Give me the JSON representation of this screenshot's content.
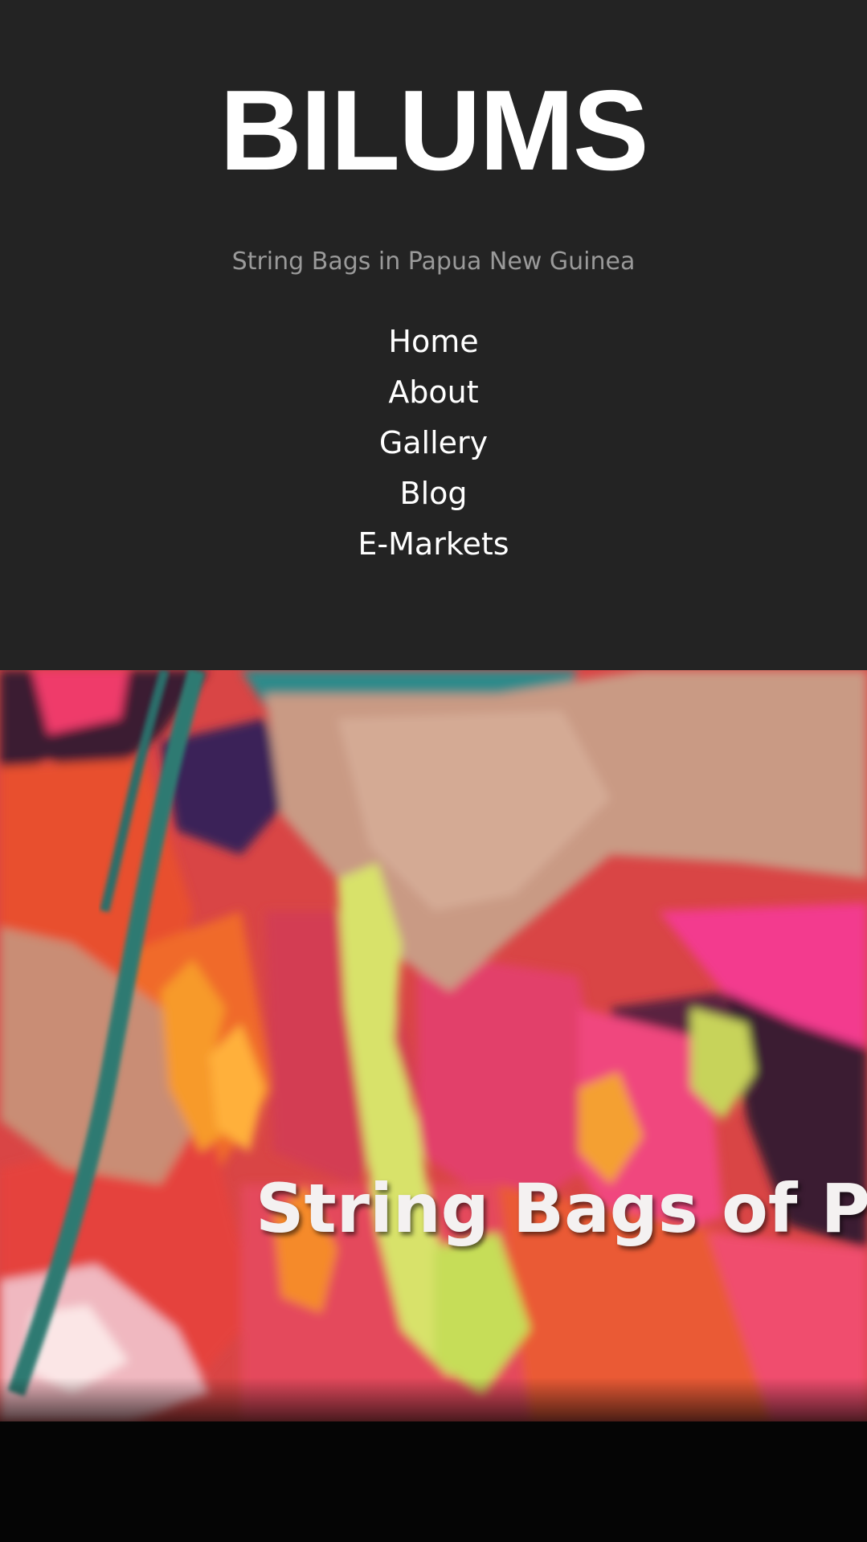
{
  "site": {
    "title": "BILUMS",
    "tagline": "String Bags in Papua New Guinea"
  },
  "nav": {
    "items": [
      {
        "label": "Home"
      },
      {
        "label": "About"
      },
      {
        "label": "Gallery"
      },
      {
        "label": "Blog"
      },
      {
        "label": "E-Markets"
      }
    ]
  },
  "hero": {
    "caption": "String Bags of Pap"
  },
  "colors": {
    "header_bg": "#232323",
    "title": "#ffffff",
    "tagline": "#9a9a9a",
    "nav_link": "#ffffff",
    "hero_bottom": "#050505"
  }
}
